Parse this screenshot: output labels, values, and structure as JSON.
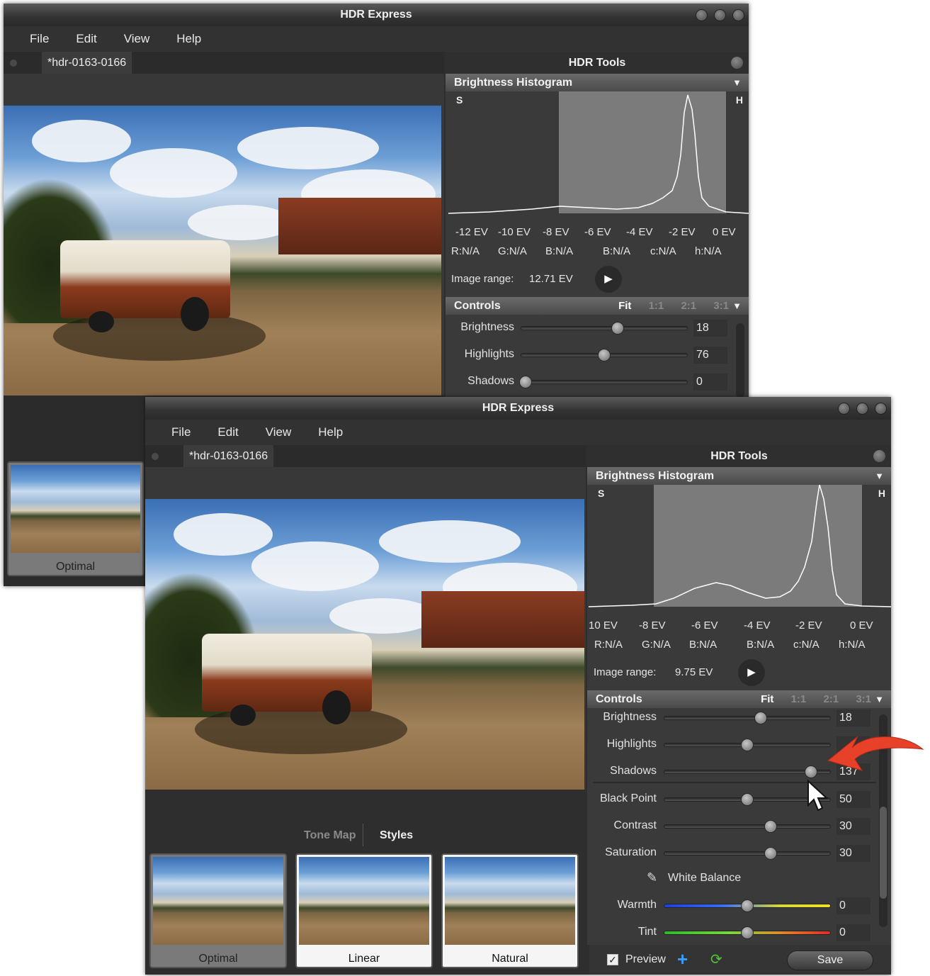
{
  "app_title": "HDR Express",
  "menu": [
    "File",
    "Edit",
    "View",
    "Help"
  ],
  "doc_tab": "*hdr-0163-0166",
  "panel_title": "HDR Tools",
  "histogram": {
    "title": "Brightness Histogram",
    "shadow_label": "S",
    "highlight_label": "H",
    "info": [
      "R:N/A",
      "G:N/A",
      "B:N/A",
      "B:N/A",
      "c:N/A",
      "h:N/A"
    ],
    "range_label": "Image range:"
  },
  "back_window": {
    "ev_labels": [
      "-12 EV",
      "-10 EV",
      "-8 EV",
      "-6 EV",
      "-4 EV",
      "-2 EV",
      "0 EV"
    ],
    "image_range": "12.71 EV",
    "controls": [
      {
        "label": "Brightness",
        "value": "18",
        "level": 0.58
      },
      {
        "label": "Highlights",
        "value": "76",
        "level": 0.5
      },
      {
        "label": "Shadows",
        "value": "0",
        "level": 0.03
      }
    ],
    "thumbnail_label": "Optimal"
  },
  "front_window": {
    "ev_labels": [
      "10 EV",
      "-8 EV",
      "-6 EV",
      "-4 EV",
      "-2 EV",
      "0 EV"
    ],
    "image_range": "9.75 EV",
    "controls": [
      {
        "label": "Brightness",
        "value": "18",
        "level": 0.58
      },
      {
        "label": "Highlights",
        "value": "",
        "level": 0.5
      },
      {
        "label": "Shadows",
        "value": "137",
        "level": 0.88
      }
    ],
    "controls2": [
      {
        "label": "Black Point",
        "value": "50",
        "level": 0.5
      },
      {
        "label": "Contrast",
        "value": "30",
        "level": 0.64
      },
      {
        "label": "Saturation",
        "value": "30",
        "level": 0.64
      }
    ],
    "white_balance_label": "White Balance",
    "color_controls": [
      {
        "label": "Warmth",
        "value": "0",
        "level": 0.5
      },
      {
        "label": "Tint",
        "value": "0",
        "level": 0.5
      }
    ],
    "styles_tabs": [
      "Tone Map",
      "Styles"
    ],
    "thumbnails": [
      "Optimal",
      "Linear",
      "Natural"
    ]
  },
  "controls_title": "Controls",
  "zoom_options": [
    "Fit",
    "1:1",
    "2:1",
    "3:1"
  ],
  "footer": {
    "preview_label": "Preview",
    "save_label": "Save"
  },
  "colors": {
    "accent_arrow": "#e8412a",
    "plus_icon": "#3a9cff",
    "refresh_icon": "#56c23d"
  }
}
